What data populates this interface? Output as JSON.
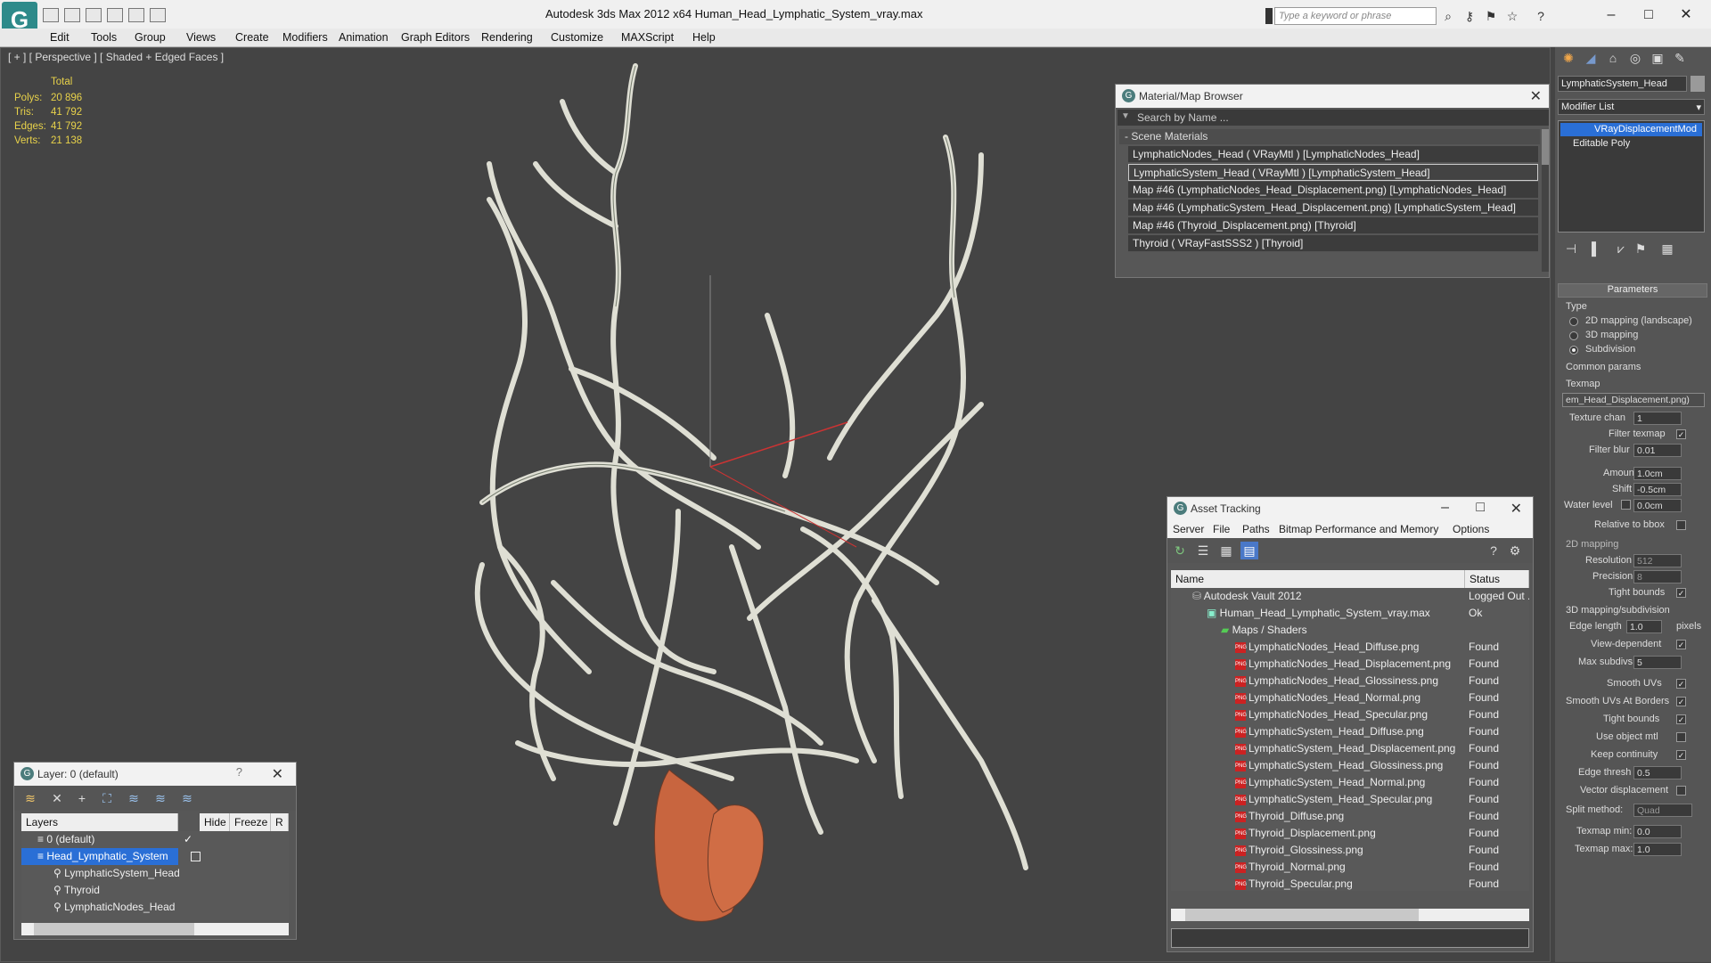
{
  "app": {
    "title": "Autodesk 3ds Max  2012 x64      Human_Head_Lymphatic_System_vray.max",
    "search_placeholder": "Type a keyword or phrase"
  },
  "menu": [
    "Edit",
    "Tools",
    "Group",
    "Views",
    "Create",
    "Modifiers",
    "Animation",
    "Graph Editors",
    "Rendering",
    "Customize",
    "MAXScript",
    "Help"
  ],
  "viewport": {
    "label": "[ + ] [ Perspective ] [ Shaded + Edged Faces ]",
    "stats": {
      "header": "Total",
      "rows": [
        {
          "label": "Polys:",
          "value": "20 896"
        },
        {
          "label": "Tris:",
          "value": "41 792"
        },
        {
          "label": "Edges:",
          "value": "41 792"
        },
        {
          "label": "Verts:",
          "value": "21 138"
        }
      ]
    }
  },
  "material_browser": {
    "title": "Material/Map Browser",
    "search_placeholder": "Search by Name ...",
    "group": "- Scene Materials",
    "items": [
      "LymphaticNodes_Head  ( VRayMtl )  [LymphaticNodes_Head]",
      "LymphaticSystem_Head  ( VRayMtl )  [LymphaticSystem_Head]",
      "Map #46 (LymphaticNodes_Head_Displacement.png)  [LymphaticNodes_Head]",
      "Map #46 (LymphaticSystem_Head_Displacement.png)  [LymphaticSystem_Head]",
      "Map #46 (Thyroid_Displacement.png)  [Thyroid]",
      "Thyroid  ( VRayFastSSS2 )  [Thyroid]"
    ]
  },
  "asset_tracking": {
    "title": "Asset Tracking",
    "menu": [
      "Server",
      "File",
      "Paths",
      "Bitmap Performance and Memory",
      "Options"
    ],
    "columns": {
      "name": "Name",
      "status": "Status"
    },
    "rows": [
      {
        "name": "Autodesk Vault 2012",
        "status": "Logged Out ..."
      },
      {
        "name": "Human_Head_Lymphatic_System_vray.max",
        "status": "Ok"
      },
      {
        "name": "Maps / Shaders",
        "status": ""
      },
      {
        "name": "LymphaticNodes_Head_Diffuse.png",
        "status": "Found"
      },
      {
        "name": "LymphaticNodes_Head_Displacement.png",
        "status": "Found"
      },
      {
        "name": "LymphaticNodes_Head_Glossiness.png",
        "status": "Found"
      },
      {
        "name": "LymphaticNodes_Head_Normal.png",
        "status": "Found"
      },
      {
        "name": "LymphaticNodes_Head_Specular.png",
        "status": "Found"
      },
      {
        "name": "LymphaticSystem_Head_Diffuse.png",
        "status": "Found"
      },
      {
        "name": "LymphaticSystem_Head_Displacement.png",
        "status": "Found"
      },
      {
        "name": "LymphaticSystem_Head_Glossiness.png",
        "status": "Found"
      },
      {
        "name": "LymphaticSystem_Head_Normal.png",
        "status": "Found"
      },
      {
        "name": "LymphaticSystem_Head_Specular.png",
        "status": "Found"
      },
      {
        "name": "Thyroid_Diffuse.png",
        "status": "Found"
      },
      {
        "name": "Thyroid_Displacement.png",
        "status": "Found"
      },
      {
        "name": "Thyroid_Glossiness.png",
        "status": "Found"
      },
      {
        "name": "Thyroid_Normal.png",
        "status": "Found"
      },
      {
        "name": "Thyroid_Specular.png",
        "status": "Found"
      }
    ]
  },
  "layer_panel": {
    "title": "Layer: 0 (default)",
    "columns": {
      "layers": "Layers",
      "hide": "Hide",
      "freeze": "Freeze",
      "r": "R"
    },
    "rows": [
      "0 (default)",
      "Head_Lymphatic_System",
      "LymphaticSystem_Head",
      "Thyroid",
      "LymphaticNodes_Head"
    ]
  },
  "command_panel": {
    "object_name": "LymphaticSystem_Head",
    "modifier_list": "Modifier List",
    "stack": [
      "VRayDisplacementMod",
      "Editable Poly"
    ],
    "rollout": "Parameters",
    "type_label": "Type",
    "type_options": [
      "2D mapping (landscape)",
      "3D mapping",
      "Subdivision"
    ],
    "common_params": "Common params",
    "texmap_label": "Texmap",
    "texmap_value": "em_Head_Displacement.png)",
    "texture_chan": {
      "label": "Texture chan",
      "value": "1"
    },
    "filter_texmap": "Filter texmap",
    "filter_blur": {
      "label": "Filter blur",
      "value": "0.01"
    },
    "amount": {
      "label": "Amount",
      "value": "1.0cm"
    },
    "shift": {
      "label": "Shift",
      "value": "-0.5cm"
    },
    "water_level": {
      "label": "Water level",
      "value": "0.0cm"
    },
    "relative_bbox": "Relative to bbox",
    "section_2d": "2D mapping",
    "resolution": {
      "label": "Resolution",
      "value": "512"
    },
    "precision": {
      "label": "Precision",
      "value": "8"
    },
    "tight_bounds_2d": "Tight bounds",
    "section_3d": "3D mapping/subdivision",
    "edge_length": {
      "label": "Edge length",
      "value": "1.0",
      "unit": "pixels"
    },
    "view_dependent": "View-dependent",
    "max_subdivs": {
      "label": "Max subdivs",
      "value": "5"
    },
    "smooth_uvs": "Smooth UVs",
    "smooth_uvs_borders": "Smooth UVs At Borders",
    "tight_bounds_3d": "Tight bounds",
    "use_object_mtl": "Use object mtl",
    "keep_continuity": "Keep continuity",
    "edge_thresh": {
      "label": "Edge thresh",
      "value": "0.5"
    },
    "vector_disp": "Vector displacement",
    "split_method": {
      "label": "Split method:",
      "value": "Quad"
    },
    "texmap_min": {
      "label": "Texmap min:",
      "value": "0.0"
    },
    "texmap_max": {
      "label": "Texmap max:",
      "value": "1.0"
    }
  }
}
